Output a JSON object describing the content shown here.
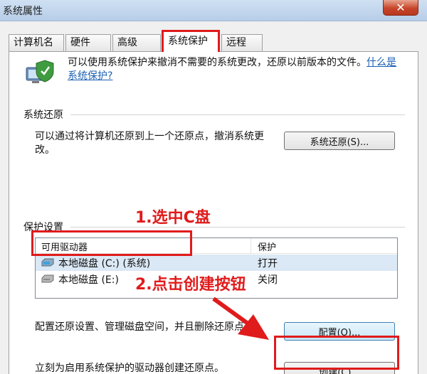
{
  "window": {
    "title": "系统属性",
    "close_glyph": "✕"
  },
  "tabs": [
    {
      "label": "计算机名"
    },
    {
      "label": "硬件"
    },
    {
      "label": "高级"
    },
    {
      "label": "系统保护",
      "active": true
    },
    {
      "label": "远程"
    }
  ],
  "intro": {
    "text": "可以使用系统保护来撤消不需要的系统更改，还原以前版本的文件。",
    "link": "什么是系统保护?"
  },
  "restore_group": {
    "label": "系统还原",
    "description": "可以通过将计算机还原到上一个还原点，撤消系统更改。",
    "button": "系统还原(S)..."
  },
  "protection_group": {
    "label": "保护设置",
    "columns": [
      "可用驱动器",
      "保护"
    ],
    "drives": [
      {
        "name": "本地磁盘 (C:) (系统)",
        "protection": "打开",
        "selected": true
      },
      {
        "name": "本地磁盘 (E:)",
        "protection": "关闭",
        "selected": false
      }
    ],
    "configure_text": "配置还原设置、管理磁盘空间，并且删除还原点。",
    "configure_button": "配置(O)...",
    "create_text": "立刻为启用系统保护的驱动器创建还原点。",
    "create_button": "创建(C)..."
  },
  "annotations": {
    "step1": "1.选中C盘",
    "step2": "2.点击创建按钮",
    "color": "#e01b1b"
  }
}
